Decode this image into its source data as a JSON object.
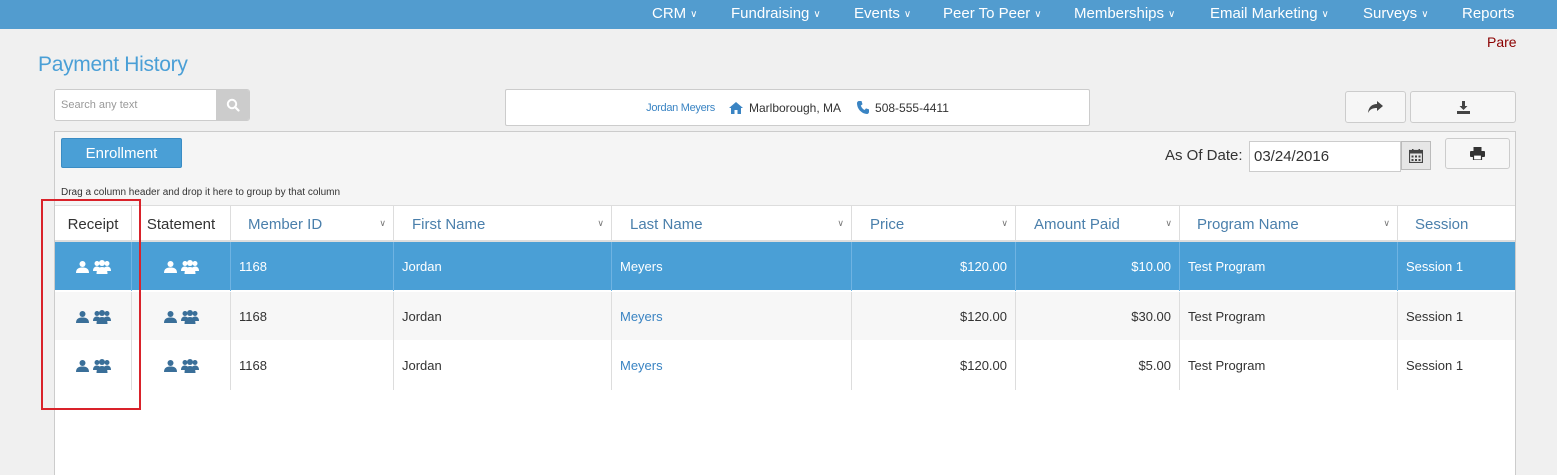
{
  "nav": {
    "items": [
      {
        "label": "CRM"
      },
      {
        "label": "Fundraising"
      },
      {
        "label": "Events"
      },
      {
        "label": "Peer To Peer"
      },
      {
        "label": "Memberships"
      },
      {
        "label": "Email Marketing"
      },
      {
        "label": "Surveys"
      },
      {
        "label": "Reports"
      }
    ],
    "parent_link": "Pare"
  },
  "page": {
    "title": "Payment History"
  },
  "search": {
    "placeholder": "Search any text",
    "icon": "search-icon"
  },
  "contact": {
    "name": "Jordan Meyers",
    "location": "Marlborough, MA",
    "phone": "508-555-4411"
  },
  "toolbar": {
    "enroll_label": "Enrollment",
    "asof_label": "As Of Date:",
    "asof_value": "03/24/2016",
    "group_hint": "Drag a column header and drop it here to group by that column"
  },
  "grid": {
    "columns": [
      "Receipt",
      "Statement",
      "Member ID",
      "First Name",
      "Last Name",
      "Price",
      "Amount Paid",
      "Program Name",
      "Session"
    ],
    "rows": [
      {
        "member_id": "1168",
        "first_name": "Jordan",
        "last_name": "Meyers",
        "price": "$120.00",
        "amount_paid": "$10.00",
        "program": "Test Program",
        "session": "Session 1",
        "selected": true
      },
      {
        "member_id": "1168",
        "first_name": "Jordan",
        "last_name": "Meyers",
        "price": "$120.00",
        "amount_paid": "$30.00",
        "program": "Test Program",
        "session": "Session 1",
        "selected": false
      },
      {
        "member_id": "1168",
        "first_name": "Jordan",
        "last_name": "Meyers",
        "price": "$120.00",
        "amount_paid": "$5.00",
        "program": "Test Program",
        "session": "Session 1",
        "selected": false
      }
    ]
  },
  "colors": {
    "nav_bg": "#529ccf",
    "accent": "#4a9fd6",
    "highlight_box": "#d9222a"
  }
}
